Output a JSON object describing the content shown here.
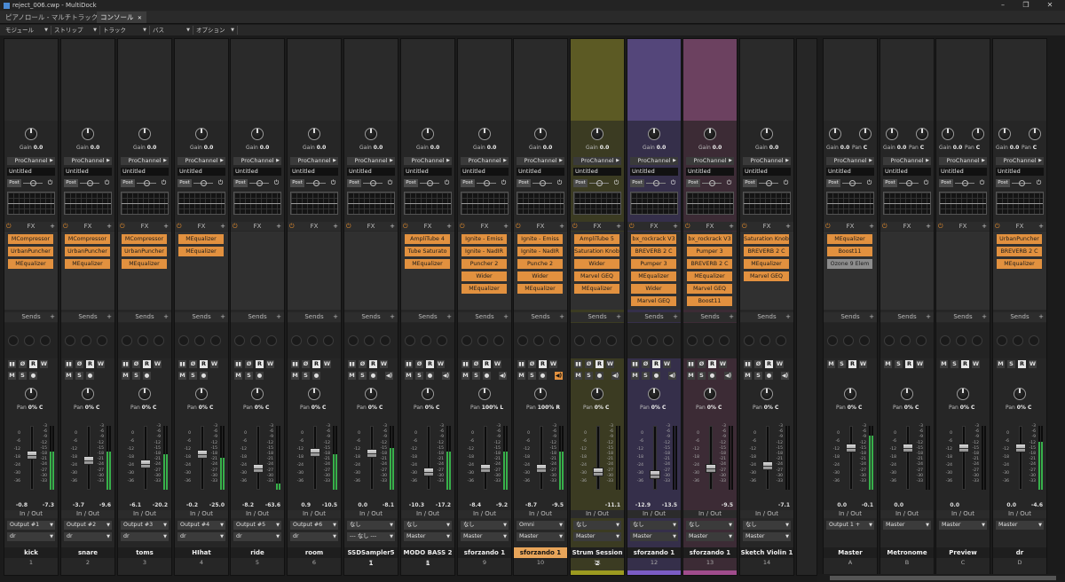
{
  "window": {
    "title": "reject_006.cwp - MultiDock",
    "controls": [
      "–",
      "❐",
      "✕"
    ]
  },
  "tabs": [
    {
      "label": "ピアノロール - マルチトラック",
      "active": false
    },
    {
      "label": "コンソール",
      "active": true,
      "close": "✕"
    }
  ],
  "menu": [
    "モジュール",
    "ストリップ",
    "トラック",
    "バス",
    "オプション"
  ],
  "common": {
    "gain_label": "Gain",
    "prochannel": "ProChannel",
    "untitled": "Untitled",
    "post": "Post",
    "fx": "FX",
    "sends": "Sends",
    "inout": "In / Out",
    "pan_label": "Pan",
    "fader_scale": [
      "-3",
      "-6",
      "-9",
      "-12",
      "-15",
      "-18",
      "-21",
      "-24",
      "-27",
      "-30",
      "-33"
    ],
    "left_scale": [
      "0",
      "-6",
      "-12",
      "-18",
      "-24",
      "-30",
      "-36"
    ]
  },
  "tracks": [
    {
      "name": "kick",
      "num": "1",
      "gain": "0.0",
      "pan": "0% C",
      "fx": [
        "MCompressor",
        "UrbanPuncher",
        "MEqualizer"
      ],
      "vol": "-0.8",
      "peak": "-7.3",
      "out": "Output #1",
      "in": "dr",
      "color": "",
      "fader": 0.55,
      "meter": 0.6
    },
    {
      "name": "snare",
      "num": "2",
      "gain": "0.0",
      "pan": "0% C",
      "fx": [
        "MCompressor",
        "UrbanPuncher",
        "MEqualizer"
      ],
      "vol": "-3.7",
      "peak": "-9.6",
      "out": "Output #2",
      "in": "dr",
      "color": "",
      "fader": 0.45,
      "meter": 0.6
    },
    {
      "name": "toms",
      "num": "3",
      "gain": "0.0",
      "pan": "0% C",
      "fx": [
        "MCompressor",
        "UrbanPuncher",
        "MEqualizer"
      ],
      "vol": "-6.1",
      "peak": "-20.2",
      "out": "Output #3",
      "in": "dr",
      "color": "",
      "fader": 0.38,
      "meter": 0.55
    },
    {
      "name": "HIhat",
      "num": "4",
      "gain": "0.0",
      "pan": "0% C",
      "fx": [
        "MEqualizer",
        "MEqualizer"
      ],
      "vol": "-0.2",
      "peak": "-25.0",
      "out": "Output #4",
      "in": "dr",
      "color": "",
      "fader": 0.57,
      "meter": 0.5
    },
    {
      "name": "ride",
      "num": "5",
      "gain": "0.0",
      "pan": "0% C",
      "fx": [],
      "vol": "-8.2",
      "peak": "-63.6",
      "out": "Output #5",
      "in": "dr",
      "color": "",
      "fader": 0.3,
      "meter": 0.1
    },
    {
      "name": "room",
      "num": "6",
      "gain": "0.0",
      "pan": "0% C",
      "fx": [],
      "vol": "0.9",
      "peak": "-10.5",
      "out": "Output #6",
      "in": "dr",
      "color": "",
      "fader": 0.6,
      "meter": 0.55
    },
    {
      "name": "SSDSampler5 1",
      "num": "7",
      "gain": "0.0",
      "pan": "0% C",
      "fx": [],
      "vol": "0.0",
      "peak": "-8.1",
      "out": "なし",
      "in": "--- なし ---",
      "color": "",
      "fader": 0.58,
      "meter": 0.65
    },
    {
      "name": "MODO BASS 2 1",
      "num": "8",
      "gain": "0.0",
      "pan": "0% C",
      "fx": [
        "AmpliTube 4",
        "Tube Saturato",
        "MEqualizer"
      ],
      "vol": "-10.3",
      "peak": "-17.2",
      "out": "なし",
      "in": "Master",
      "color": "",
      "fader": 0.25,
      "meter": 0.6
    },
    {
      "name": "sforzando 1",
      "num": "9",
      "gain": "0.0",
      "pan": "100% L",
      "fx": [
        "Ignite - Emiss",
        "Ignite - NadIR",
        "Puncher 2",
        "Wider",
        "MEqualizer"
      ],
      "vol": "-8.4",
      "peak": "-9.2",
      "out": "なし",
      "in": "Master",
      "color": "",
      "fader": 0.3,
      "meter": 0.6
    },
    {
      "name": "sforzando 1",
      "num": "10",
      "gain": "0.0",
      "pan": "100% R",
      "fx": [
        "Ignite - Emiss",
        "Ignite - NadIR",
        "Punche 2",
        "Wider",
        "MEqualizer"
      ],
      "vol": "-8.7",
      "peak": "-9.5",
      "out": "Omni",
      "in": "Master",
      "color": "",
      "fader": 0.3,
      "meter": 0.6,
      "hl_name": true
    },
    {
      "name": "Strum Session 2",
      "num": "11",
      "gain": "0.0",
      "pan": "0% C",
      "fx": [
        "AmpliTube 5",
        "Saturation Knob",
        "Wider",
        "Marvel GEQ",
        "MEqualizer"
      ],
      "vol": "",
      "peak": "-11.1",
      "out": "なし",
      "in": "Master",
      "color": "#9c9a20",
      "theme": "yellow",
      "fader": 0.24,
      "meter": 0.0
    },
    {
      "name": "sforzando 1",
      "num": "12",
      "gain": "0.0",
      "pan": "0% C",
      "fx": [
        "bx_rockrack V3",
        "BREVERB 2 C",
        "Pumper 3",
        "MEqualizer",
        "Wider",
        "Marvel GEQ"
      ],
      "vol": "-12.9",
      "peak": "-13.5",
      "out": "なし",
      "in": "Master",
      "color": "#7b5cc4",
      "theme": "purple",
      "fader": 0.2,
      "meter": 0.0
    },
    {
      "name": "sforzando 1",
      "num": "13",
      "gain": "0.0",
      "pan": "0% C",
      "fx": [
        "bx_rockrack V3",
        "Pumper 3",
        "BREVERB 2 C",
        "MEqualizer",
        "Marvel GEQ",
        "Boost11"
      ],
      "vol": "",
      "peak": "-9.5",
      "out": "なし",
      "in": "Master",
      "color": "#a04c8c",
      "theme": "pink",
      "fader": 0.3,
      "meter": 0.0
    },
    {
      "name": "Sketch Violin 1",
      "num": "14",
      "gain": "0.0",
      "pan": "0% C",
      "fx": [
        "Saturation Knob",
        "BREVERB 2 C",
        "MEqualizer",
        "Marvel GEQ"
      ],
      "vol": "",
      "peak": "-7.1",
      "out": "なし",
      "in": "Master",
      "color": "",
      "fader": 0.35,
      "meter": 0.0
    }
  ],
  "buses": [
    {
      "name": "Master",
      "num": "A",
      "gain": "0.0",
      "pan": "0% C",
      "pan_short": "C",
      "fx": [
        "MEqualizer",
        "Boost11"
      ],
      "fx_gray": [
        "Ozone 9 Elem"
      ],
      "vol": "0.0",
      "peak": "-0.1",
      "out": "Output 1 +",
      "in": "",
      "fader": 0.68,
      "meter": 0.85
    },
    {
      "name": "Metronome",
      "num": "B",
      "gain": "0.0",
      "pan": "0% C",
      "pan_short": "C",
      "fx": [],
      "fx_gray": [],
      "vol": "0.0",
      "peak": "",
      "out": "Master",
      "in": "",
      "fader": 0.68,
      "meter": 0.0
    },
    {
      "name": "Preview",
      "num": "C",
      "gain": "0.0",
      "pan": "0% C",
      "pan_short": "C",
      "fx": [],
      "fx_gray": [],
      "vol": "0.0",
      "peak": "",
      "out": "Master",
      "in": "",
      "fader": 0.68,
      "meter": 0.0
    },
    {
      "name": "dr",
      "num": "D",
      "gain": "0.0",
      "pan": "0% C",
      "pan_short": "C",
      "fx": [
        "UrbanPuncher",
        "BREVERB 2 C",
        "MEqualizer"
      ],
      "fx_gray": [],
      "vol": "0.0",
      "peak": "-4.6",
      "out": "Master",
      "in": "",
      "fader": 0.68,
      "meter": 0.75
    }
  ]
}
